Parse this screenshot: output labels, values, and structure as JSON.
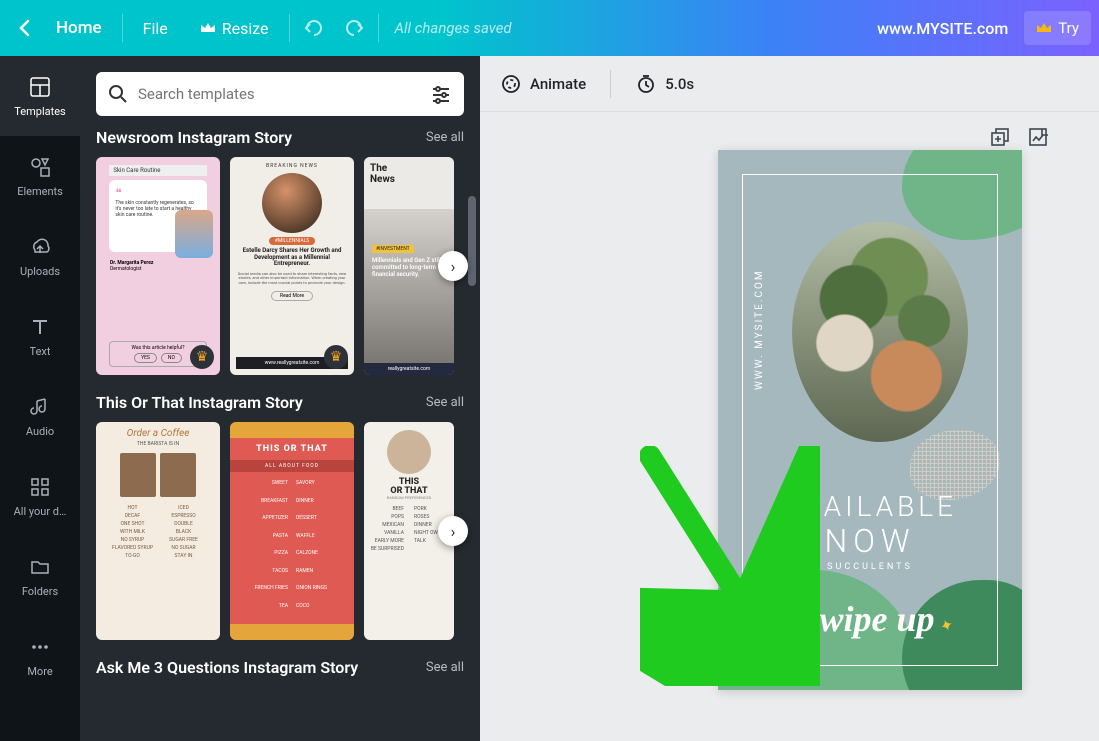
{
  "topbar": {
    "home": "Home",
    "file": "File",
    "resize": "Resize",
    "saved": "All changes saved",
    "url": "www.MYSITE.com",
    "try": "Try"
  },
  "rail": {
    "templates": "Templates",
    "elements": "Elements",
    "uploads": "Uploads",
    "text": "Text",
    "audio": "Audio",
    "all_designs": "All your d…",
    "folders": "Folders",
    "more": "More"
  },
  "panel": {
    "search_placeholder": "Search templates",
    "see_all": "See all",
    "cats": {
      "newsroom": {
        "title": "Newsroom Instagram Story"
      },
      "this_or_that": {
        "title": "This Or That Instagram Story"
      },
      "ask_me": {
        "title": "Ask Me 3 Questions Instagram Story"
      }
    },
    "cards": {
      "pink": {
        "bar": "Skin Care Routine",
        "quote": "The skin constantly regenerates, so it's never too late to start a healthy skin care routine.",
        "author": "Dr. Margarita Perez",
        "role": "Dermatologist",
        "foot_q": "Was this article helpful?",
        "yes": "YES",
        "no": "NO"
      },
      "news": {
        "tag": "BREAKING NEWS",
        "pill": "#MILLENNIALS",
        "headline": "Estelle Darcy Shares Her Growth and Development as a Millennial Entrepreneur.",
        "body": "Social media can also be used to share interesting facts, new stories, and other important information. When creating your own, include the most crucial points to promote your design.",
        "read": "Read More",
        "brand": "www.reallygreatsite.com"
      },
      "news2": {
        "title1": "The",
        "title2": "News",
        "badge": "#INVESTMENT",
        "cap": "Millennials and Gen Z still committed to long-term financial security.",
        "brand": "reallygreatsite.com"
      },
      "coffee": {
        "h": "Order a Coffee",
        "sub": "THE BARISTA IS IN",
        "items": [
          "HOT",
          "ICED",
          "DECAF",
          "ESPRESSO",
          "ONE SHOT",
          "DOUBLE",
          "WITH MILK",
          "BLACK",
          "NO SYRUP",
          "SUGAR FREE",
          "FLAVORED SYRUP",
          "NO SUGAR",
          "TO-GO",
          "STAY IN"
        ]
      },
      "food": {
        "title": "THIS OR THAT",
        "sub": "ALL ABOUT FOOD",
        "items": [
          "SWEET",
          "SAVORY",
          "BREAKFAST",
          "DINNER",
          "APPETIZER",
          "DESSERT",
          "PASTA",
          "WAFFLE",
          "PIZZA",
          "CALZONE",
          "TACOS",
          "RAMEN",
          "FRENCH FRIES",
          "ONION RINGS",
          "TEA",
          "COCO"
        ]
      },
      "pref": {
        "h1": "THIS",
        "h2": "OR THAT",
        "sub": "RANDOM PREFERENCES",
        "items": [
          "BEEF",
          "PORK",
          "POPS",
          "ROSES",
          "MEXICAN",
          "DINNER",
          "VANILLA",
          "NIGHT OWL",
          "EARLY MORE",
          "TALK",
          "BE SURPRISED"
        ]
      }
    }
  },
  "canvas": {
    "animate": "Animate",
    "duration": "5.0s",
    "story": {
      "side_url": "WWW. MYSITE.COM",
      "h1": "AVAILABLE",
      "h2": "NOW",
      "sub": "SUCCULENTS",
      "swipe": "swipe up"
    }
  }
}
